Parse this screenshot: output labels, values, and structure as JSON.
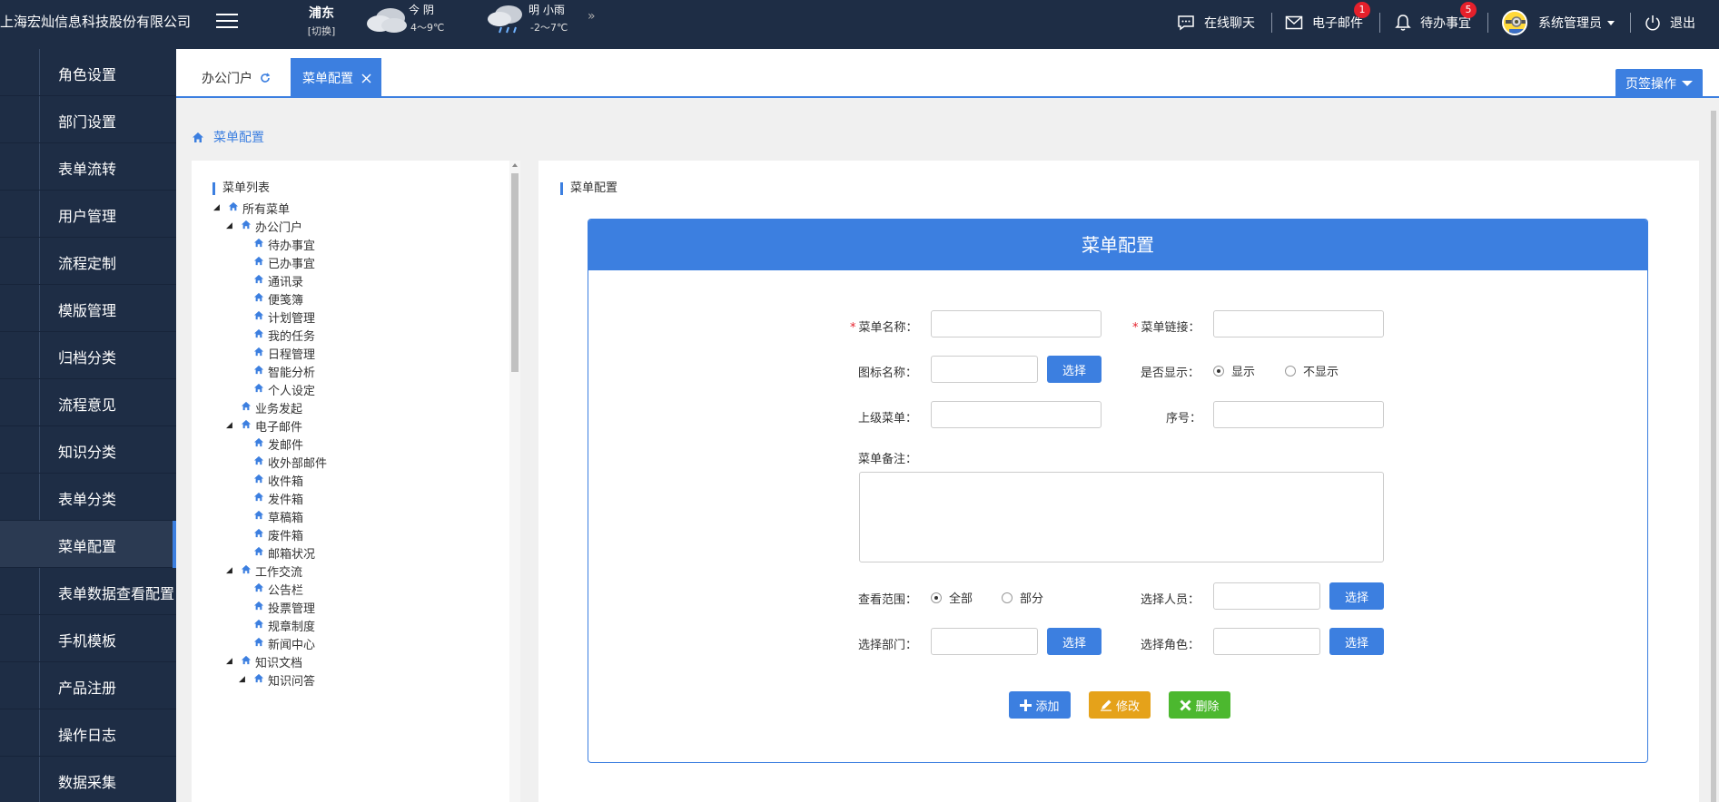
{
  "header": {
    "company": "上海宏灿信息科技股份有限公司",
    "location": {
      "name": "浦东",
      "switch": "[切换]"
    },
    "weather": [
      {
        "day_label": "今 阴",
        "temp": "4～9℃",
        "icon": "cloudy-icon"
      },
      {
        "day_label": "明 小雨",
        "temp": "-2～7℃",
        "icon": "rain-icon"
      }
    ],
    "more": "»",
    "chat": "在线聊天",
    "email": {
      "label": "电子邮件",
      "badge": "1"
    },
    "todo": {
      "label": "待办事宜",
      "badge": "5"
    },
    "user": "系统管理员",
    "logout": "退出"
  },
  "sidebar": {
    "items": [
      "角色设置",
      "部门设置",
      "表单流转",
      "用户管理",
      "流程定制",
      "模版管理",
      "归档分类",
      "流程意见",
      "知识分类",
      "表单分类",
      "菜单配置",
      "表单数据查看配置",
      "手机模板",
      "产品注册",
      "操作日志",
      "数据采集"
    ],
    "active": "菜单配置"
  },
  "tabs": [
    {
      "label": "办公门户"
    },
    {
      "label": "菜单配置"
    }
  ],
  "page_ops": "页签操作",
  "breadcrumb": "菜单配置",
  "tree": {
    "title": "菜单列表",
    "nodes": [
      "所有菜单",
      "办公门户",
      "待办事宜",
      "已办事宜",
      "通讯录",
      "便笺簿",
      "计划管理",
      "我的任务",
      "日程管理",
      "智能分析",
      "个人设定",
      "业务发起",
      "电子邮件",
      "发邮件",
      "收外部邮件",
      "收件箱",
      "发件箱",
      "草稿箱",
      "废件箱",
      "邮箱状况",
      "工作交流",
      "公告栏",
      "投票管理",
      "规章制度",
      "新闻中心",
      "知识文档",
      "知识问答"
    ]
  },
  "config": {
    "panel_title": "菜单配置",
    "form_title": "菜单配置",
    "labels": {
      "menu_name": "菜单名称：",
      "menu_link": "菜单链接：",
      "icon_name": "图标名称：",
      "show": "是否显示：",
      "parent": "上级菜单：",
      "order": "序号：",
      "remark": "菜单备注：",
      "scope": "查看范围：",
      "person": "选择人员：",
      "dept": "选择部门：",
      "role": "选择角色："
    },
    "required_mark": "*",
    "select_btn": "选择",
    "show_options": [
      "显示",
      "不显示"
    ],
    "scope_options": [
      "全部",
      "部分"
    ],
    "actions": {
      "add": "添加",
      "edit": "修改",
      "delete": "删除"
    },
    "values": {
      "menu_name": "",
      "menu_link": "",
      "icon_name": "",
      "parent": "",
      "order": "",
      "remark": "",
      "person": "",
      "dept": "",
      "role": ""
    }
  },
  "colors": {
    "nav_bg": "#1e2d45",
    "primary": "#3c7fe0",
    "edit": "#e5a21a",
    "delete": "#4cb82f",
    "badge": "#e5202b"
  }
}
